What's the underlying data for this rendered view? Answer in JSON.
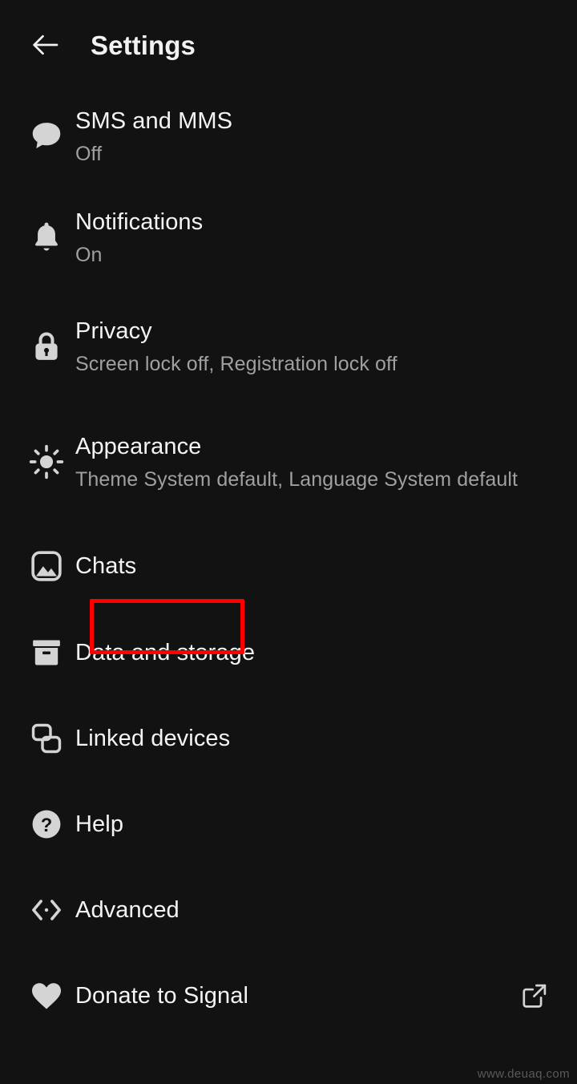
{
  "app": {
    "background_color": "#121212",
    "accent_highlight_color": "#fe0000",
    "title_color": "#f4f4f4",
    "subtitle_color": "#a0a0a0"
  },
  "header": {
    "back_icon": "arrow-left-icon",
    "title": "Settings"
  },
  "settings": {
    "items": [
      {
        "icon": "chat-bubble-icon",
        "title": "SMS and MMS",
        "subtitle": "Off",
        "highlighted": false,
        "trailing_icon": null
      },
      {
        "icon": "bell-icon",
        "title": "Notifications",
        "subtitle": "On",
        "highlighted": false,
        "trailing_icon": null
      },
      {
        "icon": "lock-icon",
        "title": "Privacy",
        "subtitle": "Screen lock off, Registration lock off",
        "highlighted": false,
        "trailing_icon": null
      },
      {
        "icon": "sun-icon",
        "title": "Appearance",
        "subtitle": "Theme System default, Language System default",
        "highlighted": false,
        "trailing_icon": null
      },
      {
        "icon": "image-icon",
        "title": "Chats",
        "subtitle": null,
        "highlighted": true,
        "trailing_icon": null
      },
      {
        "icon": "archive-box-icon",
        "title": "Data and storage",
        "subtitle": null,
        "highlighted": false,
        "trailing_icon": null
      },
      {
        "icon": "linked-devices-icon",
        "title": "Linked devices",
        "subtitle": null,
        "highlighted": false,
        "trailing_icon": null
      },
      {
        "icon": "question-mark-circle-icon",
        "title": "Help",
        "subtitle": null,
        "highlighted": false,
        "trailing_icon": null
      },
      {
        "icon": "code-brackets-icon",
        "title": "Advanced",
        "subtitle": null,
        "highlighted": false,
        "trailing_icon": null
      },
      {
        "icon": "heart-icon",
        "title": "Donate to Signal",
        "subtitle": null,
        "highlighted": false,
        "trailing_icon": "external-link-icon"
      }
    ]
  },
  "watermark": {
    "text": "www.deuaq.com"
  }
}
